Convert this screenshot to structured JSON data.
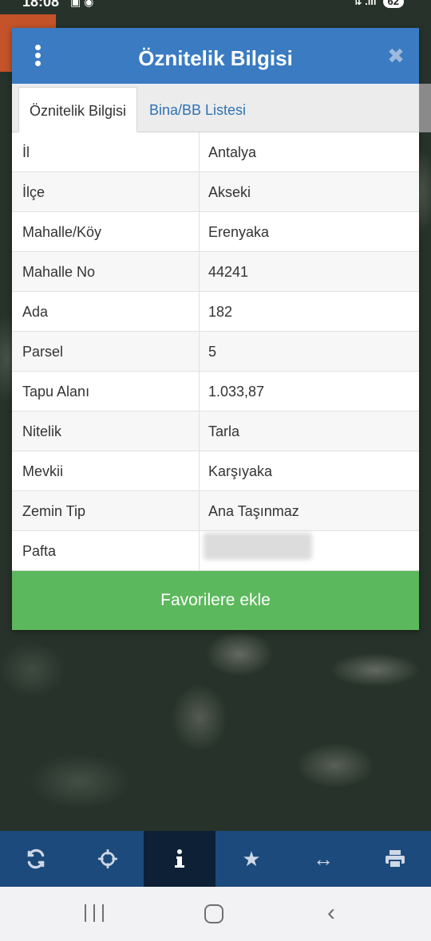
{
  "status_bar": {
    "time": "18:08",
    "battery": "62"
  },
  "modal": {
    "title": "Öznitelik Bilgisi",
    "tabs": [
      {
        "label": "Öznitelik Bilgisi",
        "active": true
      },
      {
        "label": "Bina/BB Listesi",
        "active": false
      }
    ],
    "rows": [
      {
        "label": "İl",
        "value": "Antalya"
      },
      {
        "label": "İlçe",
        "value": "Akseki"
      },
      {
        "label": "Mahalle/Köy",
        "value": "Erenyaka"
      },
      {
        "label": "Mahalle No",
        "value": "44241"
      },
      {
        "label": "Ada",
        "value": "182"
      },
      {
        "label": "Parsel",
        "value": "5"
      },
      {
        "label": "Tapu Alanı",
        "value": "1.033,87"
      },
      {
        "label": "Nitelik",
        "value": "Tarla"
      },
      {
        "label": "Mevkii",
        "value": "Karşıyaka"
      },
      {
        "label": "Zemin Tip",
        "value": "Ana Taşınmaz"
      },
      {
        "label": "Pafta",
        "value": ""
      }
    ],
    "favorite_button": "Favorilere ekle"
  },
  "toolbar": {
    "items": [
      {
        "icon": "refresh-icon"
      },
      {
        "icon": "crosshair-icon"
      },
      {
        "icon": "info-icon",
        "active": true
      },
      {
        "icon": "star-icon"
      },
      {
        "icon": "measure-icon"
      },
      {
        "icon": "print-icon"
      }
    ]
  },
  "colors": {
    "header": "#3a7bc2",
    "tab_link": "#2f72b3",
    "favorite_button": "#5cb85c",
    "toolbar": "#1c4a7c",
    "toolbar_active": "#0d2035"
  }
}
